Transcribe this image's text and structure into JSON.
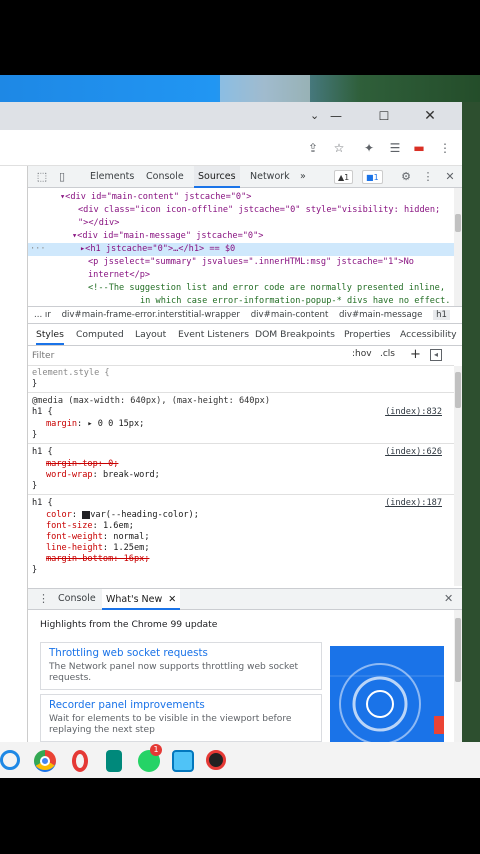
{
  "window": {
    "controls": {
      "minimize": "—",
      "maximize": "☐",
      "close": "✕"
    }
  },
  "devtools": {
    "tabs": [
      "Elements",
      "Console",
      "Sources",
      "Network",
      "»"
    ],
    "active_tab": "Sources",
    "badges": {
      "warnings": "1",
      "messages": "1"
    },
    "dom_lines": [
      "▾<div id=\"main-content\" jstcache=\"0\">",
      "<div class=\"icon icon-offline\" jstcache=\"0\" style=\"visibility: hidden;",
      "\"></div>",
      "▾<div id=\"main-message\" jstcache=\"0\">",
      "▸<h1 jstcache=\"0\">…</h1> == $0",
      "<p jsselect=\"summary\" jsvalues=\".innerHTML:msg\" jstcache=\"1\">No",
      "internet</p>",
      "<!--The suggestion list and error code are normally presented inline,",
      "in which case error-information-popup-* divs have no effect."
    ],
    "breadcrumbs": [
      "... ır",
      "div#main-frame-error.interstitial-wrapper",
      "div#main-content",
      "div#main-message",
      "h1"
    ],
    "panel_tabs": [
      "Styles",
      "Computed",
      "Layout",
      "Event Listeners",
      "DOM Breakpoints",
      "Properties",
      "Accessibility"
    ],
    "filter_placeholder": "Filter",
    "filter_tools": {
      "hov": ":hov",
      "cls": ".cls",
      "plus": "+"
    },
    "styles": {
      "element_style": "element.style {",
      "close_brace": "}",
      "media": "@media (max-width: 640px), (max-height: 640px)",
      "rule1": {
        "selector": "h1 {",
        "source": "(index):832",
        "prop": "margin",
        "value": "▸ 0 0 15px;"
      },
      "rule2": {
        "selector": "h1 {",
        "source": "(index):626",
        "prop1": "margin-top: 0;",
        "prop2": "word-wrap",
        "value2": "break-word;"
      },
      "rule3": {
        "selector": "h1 {",
        "source": "(index):187",
        "color_prop": "color",
        "color_value": "var(--heading-color);",
        "font_size": "font-size",
        "font_size_value": "1.6em;",
        "font_weight": "font-weight",
        "font_weight_value": "normal;",
        "line_height": "line-height",
        "line_height_value": "1.25em;",
        "margin_bottom": "margin-bottom: 16px;"
      }
    },
    "drawer": {
      "tabs": [
        "Console",
        "What's New"
      ],
      "active": "What's New",
      "close": "✕",
      "headline": "Highlights from the Chrome 99 update",
      "cards": [
        {
          "title": "Throttling web socket requests",
          "body": "The Network panel now supports throttling web socket requests."
        },
        {
          "title": "Recorder panel improvements",
          "body": "Wait for elements to be visible in the viewport before replaying the next step"
        }
      ]
    }
  },
  "colors": {
    "accent": "#1a73e8",
    "selection": "#cfe8fc",
    "tag": "#881280"
  },
  "taskbar": {
    "notification_count": "1"
  }
}
